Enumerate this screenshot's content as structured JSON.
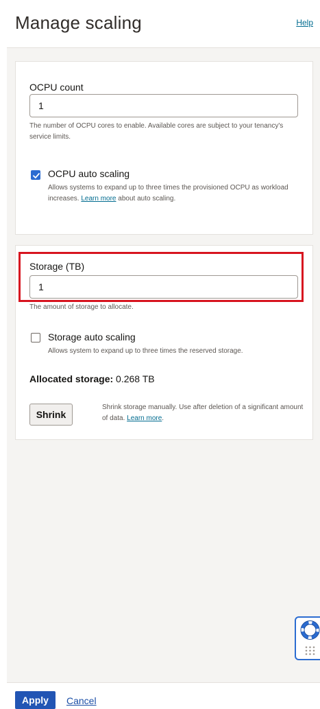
{
  "header": {
    "title": "Manage scaling",
    "help_link": "Help"
  },
  "ocpu": {
    "label": "OCPU count",
    "value": "1",
    "help_text": "The number of OCPU cores to enable. Available cores are subject to your tenancy's service limits.",
    "auto_scaling": {
      "label": "OCPU auto scaling",
      "checked": true,
      "desc_before": "Allows systems to expand up to three times the provisioned OCPU as workload increases.",
      "link": "Learn more",
      "desc_after": "about auto scaling."
    }
  },
  "storage": {
    "label": "Storage (TB)",
    "value": "1",
    "help_text": "The amount of storage to allocate.",
    "auto_scaling": {
      "label": "Storage auto scaling",
      "checked": false,
      "desc": "Allows system to expand up to three times the reserved storage."
    },
    "allocated_label": "Allocated storage:",
    "allocated_value": "0.268 TB",
    "shrink_button": "Shrink",
    "shrink_desc": "Shrink storage manually. Use after deletion of a significant amount of data.",
    "shrink_link": "Learn more",
    "shrink_link_suffix": "."
  },
  "footer": {
    "apply": "Apply",
    "cancel": "Cancel"
  },
  "colors": {
    "accent": "#2b6cd1",
    "highlight": "#d7141f",
    "apply": "#2255b4",
    "link": "#006b8f"
  },
  "icons": {
    "checkbox_checked": "checkmark-icon",
    "support": "lifebuoy-icon",
    "grid": "dots-grid-icon"
  }
}
